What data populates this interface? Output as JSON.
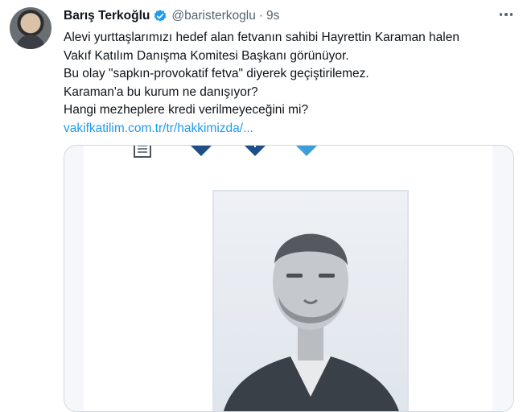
{
  "author": {
    "name": "Barış Terkoğlu",
    "handle": "@baristerkoglu",
    "separator": "·",
    "time": "9s",
    "verified_badge": "verified-badge-icon",
    "avatar": "profile-photo"
  },
  "tweet": {
    "lines": [
      "Alevi yurttaşlarımızı hedef alan fetvanın sahibi Hayrettin Karaman halen",
      "Vakıf Katılım Danışma Komitesi Başkanı görünüyor.",
      "Bu olay \"sapkın-provokatif fetva\" diyerek geçiştirilemez.",
      "Karaman'a bu kurum ne danışıyor?",
      "Hangi mezheplere kredi verilmeyeceğini mi?"
    ],
    "link": "vakifkatilim.com.tr/tr/hakkimizda/..."
  },
  "media": {
    "icons": [
      "document-icon",
      "facebook-icon",
      "linkedin-icon",
      "twitter-icon"
    ],
    "photo": "portrait-photo"
  },
  "colors": {
    "accent": "#1d9bf0",
    "muted": "#536471",
    "text": "#0f1419",
    "icon_dark_blue": "#1e4f86",
    "icon_light_blue": "#3d9ed9"
  }
}
